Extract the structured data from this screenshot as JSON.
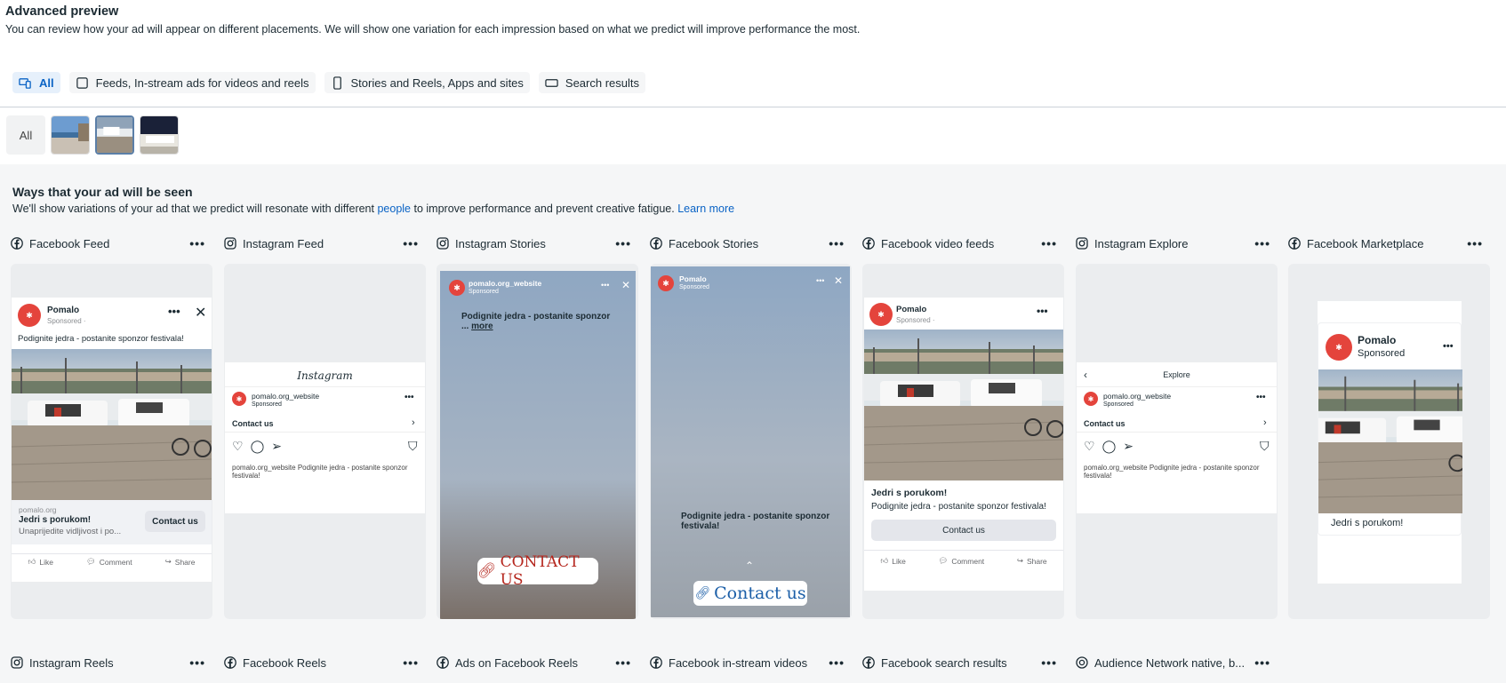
{
  "header": {
    "title": "Advanced preview",
    "description": "You can review how your ad will appear on different placements. We will show one variation for each impression based on what we predict will improve performance the most."
  },
  "tabs": [
    {
      "label": "All",
      "icon": "devices-icon",
      "active": true
    },
    {
      "label": "Feeds, In-stream ads for videos and reels",
      "icon": "square-icon"
    },
    {
      "label": "Stories and Reels, Apps and sites",
      "icon": "phone-icon"
    },
    {
      "label": "Search results",
      "icon": "rectangle-icon"
    }
  ],
  "creatives": {
    "all_label": "All"
  },
  "ways": {
    "title": "Ways that your ad will be seen",
    "text_before": "We'll show variations of your ad that we predict will resonate with different ",
    "link_people": "people",
    "text_after": " to improve performance and prevent creative fatigue. ",
    "link_learn": "Learn more"
  },
  "placements_row1": [
    {
      "name": "Facebook Feed",
      "icon": "facebook-icon"
    },
    {
      "name": "Instagram Feed",
      "icon": "instagram-icon"
    },
    {
      "name": "Instagram Stories",
      "icon": "instagram-icon"
    },
    {
      "name": "Facebook Stories",
      "icon": "facebook-icon"
    },
    {
      "name": "Facebook video feeds",
      "icon": "facebook-icon"
    },
    {
      "name": "Instagram Explore",
      "icon": "instagram-icon"
    },
    {
      "name": "Facebook Marketplace",
      "icon": "facebook-icon"
    }
  ],
  "placements_row2": [
    {
      "name": "Instagram Reels",
      "icon": "instagram-icon"
    },
    {
      "name": "Facebook Reels",
      "icon": "facebook-icon"
    },
    {
      "name": "Ads on Facebook Reels",
      "icon": "facebook-icon"
    },
    {
      "name": "Facebook in-stream videos",
      "icon": "facebook-icon"
    },
    {
      "name": "Facebook search results",
      "icon": "facebook-icon"
    },
    {
      "name": "Audience Network native, b...",
      "icon": "audience-network-icon"
    }
  ],
  "ad": {
    "page_name": "Pomalo",
    "sponsored": "Sponsored",
    "sponsored_dot": "Sponsored · ",
    "ig_handle": "pomalo.org_website",
    "primary_text": "Podignite jedra - postanite sponzor festivala!",
    "story_text": "Podignite jedra - postanite sponzor",
    "more_prefix": "... ",
    "more": "more",
    "domain": "pomalo.org",
    "headline": "Jedri s porukom!",
    "description": "Unaprijedite vidljivost i po...",
    "cta": "Contact us",
    "cta_upper": "CONTACT US",
    "ig_logo": "Instagram",
    "explore": "Explore",
    "like": "Like",
    "comment": "Comment",
    "share": "Share"
  },
  "colors": {
    "accent": "#0a63c5",
    "brand_red": "#e4443c"
  }
}
